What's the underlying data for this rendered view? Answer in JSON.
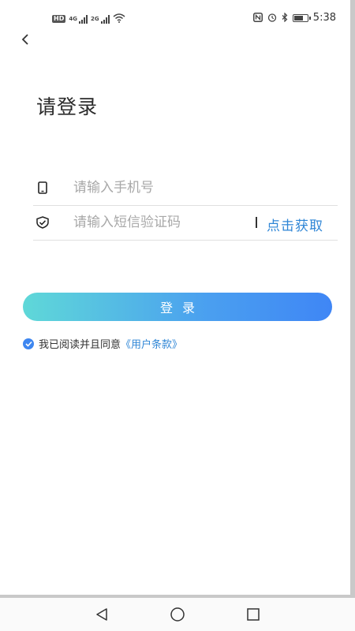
{
  "status_bar": {
    "hd_label": "HD",
    "sim1_label": "4G",
    "sim2_label": "2G",
    "time": "5:38",
    "icons": [
      "nfc-icon",
      "alarm-icon",
      "bluetooth-icon",
      "battery-icon",
      "wifi-icon"
    ],
    "battery_level": 0.75
  },
  "header": {
    "title": "请登录"
  },
  "form": {
    "phone_placeholder": "请输入手机号",
    "phone_value": "",
    "code_placeholder": "请输入短信验证码",
    "code_value": "",
    "get_code_label": "点击获取"
  },
  "login_button_label": "登录",
  "agreement": {
    "checked": true,
    "text": "我已阅读并且同意",
    "link_text": "《用户条款》"
  },
  "colors": {
    "accent": "#2f86d6",
    "button_gradient_start": "#5fd8d8",
    "button_gradient_end": "#3f86f5",
    "checkbox": "#3d86f0"
  }
}
